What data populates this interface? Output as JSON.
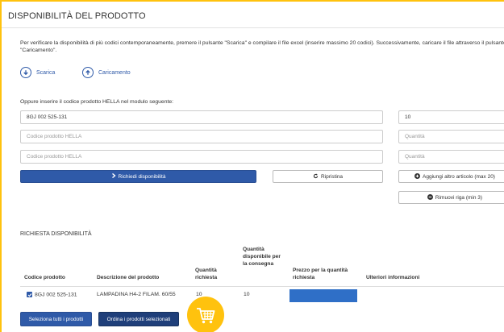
{
  "header": {
    "title": "DISPONIBILITÀ DEL PRODOTTO"
  },
  "intro": {
    "text": "Per verificare la disponibilità di più codici contemporaneamente, premere il pulsante \"Scarica\" e compilare il file excel (inserire massimo 20 codici). Successivamente, caricare il file attraverso il pulsante \"Caricamento\"."
  },
  "actions": {
    "download_label": "Scarica",
    "upload_label": "Caricamento"
  },
  "form": {
    "instruction": "Oppure inserire il codice prodotto HELLA nel modulo seguente:",
    "rows": [
      {
        "code": "8GJ 002 525-131",
        "code_placeholder": "Codice prodotto HELLA",
        "qty": "10",
        "qty_placeholder": "Quantità"
      },
      {
        "code": "",
        "code_placeholder": "Codice prodotto HELLA",
        "qty": "",
        "qty_placeholder": "Quantità"
      },
      {
        "code": "",
        "code_placeholder": "Codice prodotto HELLA",
        "qty": "",
        "qty_placeholder": "Quantità"
      }
    ],
    "request_label": "Richiedi disponibilità",
    "reset_label": "Ripristina",
    "add_label": "Aggiungi altro articolo (max 20)",
    "remove_label": "Rimuovi riga (min 3)"
  },
  "results": {
    "title": "RICHIESTA DISPONIBILITÀ",
    "headers": {
      "code": "Codice prodotto",
      "description": "Descrizione del prodotto",
      "qty_requested": "Quantità richiesta",
      "qty_available": "Quantità disponibile per la consegna",
      "price": "Prezzo per la quantità richiesta",
      "more_info": "Ulteriori informazioni"
    },
    "rows": [
      {
        "code": "8GJ 002 525-131",
        "description": "LAMPADINA H4-2 FILAM. 60/55",
        "qty_requested": "10",
        "qty_available": "10",
        "selected": true
      }
    ],
    "select_all_label": "Seleziona tutti i prodotti",
    "order_selected_label": "Ordina i prodotti selezionati"
  },
  "colors": {
    "accent": "#2f5aa8",
    "brand_yellow": "#ffc20e",
    "dark_button": "#1f3f7a"
  },
  "icons": [
    "download-icon",
    "upload-icon",
    "chevron-right-icon",
    "refresh-icon",
    "plus-circle-icon",
    "minus-circle-icon",
    "checkbox-checked-icon",
    "shopping-cart-icon"
  ]
}
